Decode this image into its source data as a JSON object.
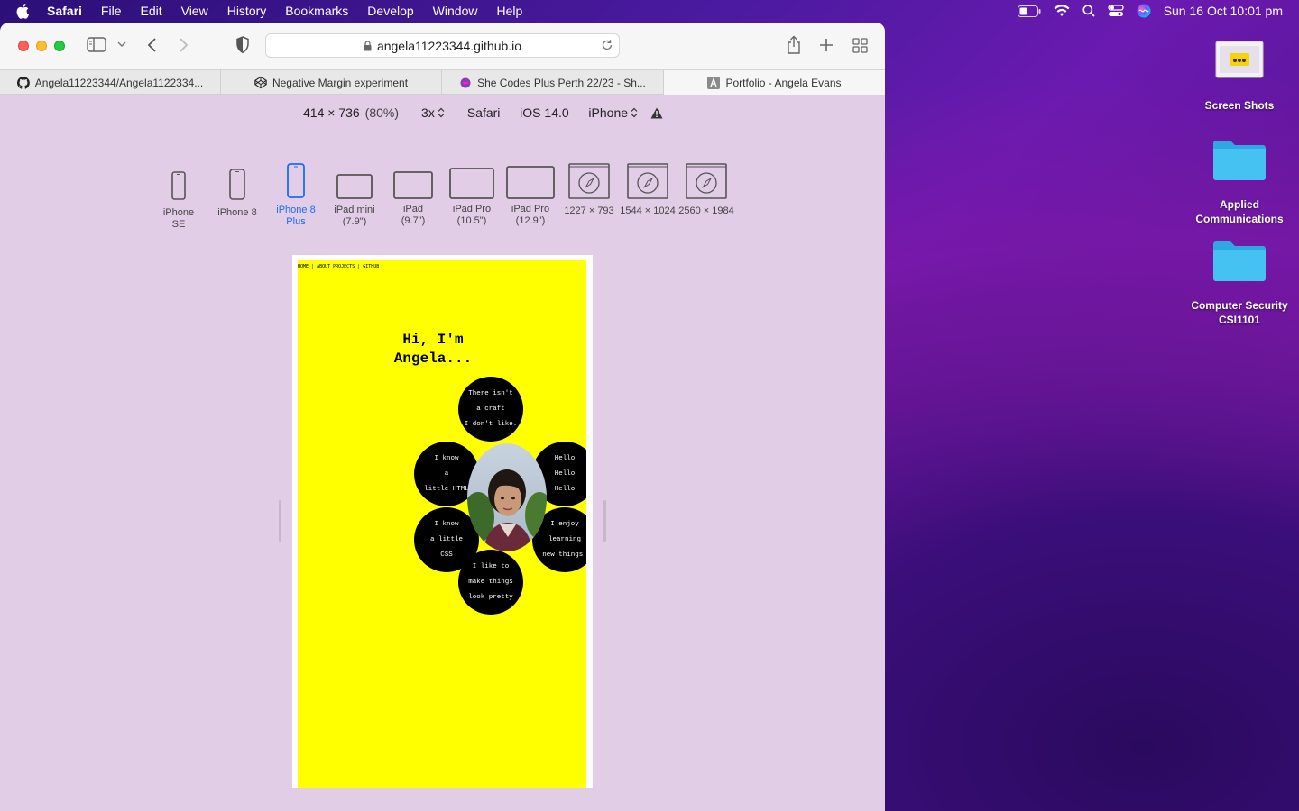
{
  "menubar": {
    "app": "Safari",
    "items": [
      "File",
      "Edit",
      "View",
      "History",
      "Bookmarks",
      "Develop",
      "Window",
      "Help"
    ],
    "clock": "Sun 16 Oct  10:01 pm"
  },
  "browser": {
    "url": "angela11223344.github.io",
    "tabs": [
      {
        "label": "Angela11223344/Angela1122334...",
        "icon": "github-icon"
      },
      {
        "label": "Negative Margin experiment",
        "icon": "codepen-icon"
      },
      {
        "label": "She Codes Plus Perth 22/23 - Sh...",
        "icon": "shecodes-icon"
      },
      {
        "label": "Portfolio - Angela Evans",
        "icon": "letter-a-icon",
        "active": true
      }
    ]
  },
  "rdm": {
    "dimensions": "414 × 736",
    "zoom": "(80%)",
    "scale": "3x",
    "user_agent": "Safari — iOS 14.0 — iPhone",
    "devices": [
      {
        "label": "iPhone SE"
      },
      {
        "label": "iPhone 8"
      },
      {
        "label": "iPhone 8 Plus",
        "selected": true
      },
      {
        "label": "iPad mini (7.9\")"
      },
      {
        "label": "iPad (9.7\")"
      },
      {
        "label": "iPad Pro (10.5\")"
      },
      {
        "label": "iPad Pro (12.9\")"
      },
      {
        "label": "1227 × 793"
      },
      {
        "label": "1544 × 1024"
      },
      {
        "label": "2560 × 1984"
      }
    ]
  },
  "site": {
    "nav": "HOME | ABOUT   PROJECTS | GITHUB",
    "heading_line1": "Hi, I'm",
    "heading_line2": "Angela...",
    "bubbles": {
      "top": [
        "There isn't",
        "a craft",
        "I don't like."
      ],
      "left_upper": [
        "I know",
        "a",
        "little HTML"
      ],
      "right_upper": [
        "Hello",
        "Hello",
        "Hello"
      ],
      "left_lower": [
        "I know",
        "a little",
        "CSS"
      ],
      "right_lower": [
        "I enjoy",
        "learning",
        "new things."
      ],
      "bottom": [
        "I like to",
        "make things",
        "look pretty"
      ]
    }
  },
  "desktop": {
    "icons": [
      {
        "label": "Screen Shots"
      },
      {
        "label": "Applied Communications"
      },
      {
        "label": "Computer Security CSI1101"
      }
    ]
  }
}
